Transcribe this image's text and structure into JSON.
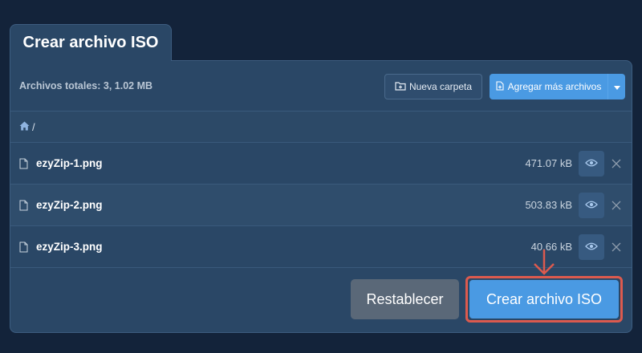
{
  "header": {
    "title": "Crear archivo ISO"
  },
  "toolbar": {
    "total_label": "Archivos totales: 3, 1.02 MB",
    "new_folder_label": "Nueva carpeta",
    "add_files_label": "Agregar más archivos"
  },
  "breadcrumb": {
    "separator": "/"
  },
  "files": [
    {
      "name": "ezyZip-1.png",
      "size": "471.07 kB"
    },
    {
      "name": "ezyZip-2.png",
      "size": "503.83 kB"
    },
    {
      "name": "ezyZip-3.png",
      "size": "40.66 kB"
    }
  ],
  "footer": {
    "reset_label": "Restablecer",
    "create_label": "Crear archivo ISO"
  },
  "colors": {
    "background": "#13233a",
    "panel": "#2a4766",
    "accent": "#4a9ae3",
    "highlight": "#dc5a4e",
    "reset": "#5a6878"
  },
  "icons": [
    "folder-plus-icon",
    "file-plus-icon",
    "chevron-down-icon",
    "home-icon",
    "file-icon",
    "eye-icon",
    "close-icon",
    "arrow-down-icon"
  ]
}
